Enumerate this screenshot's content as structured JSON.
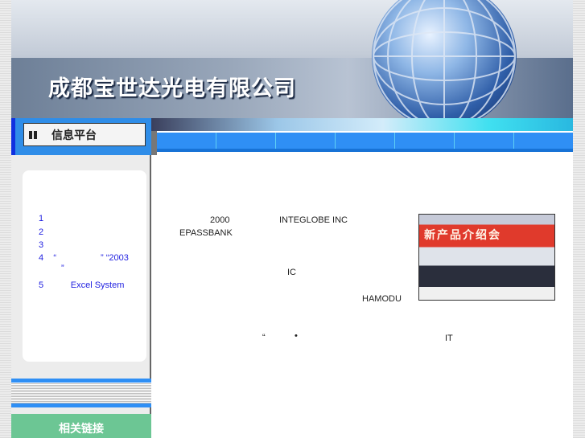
{
  "header": {
    "company_name": "成都宝世达光电有限公司"
  },
  "sidebar": {
    "info_title": "信息平台",
    "news": [
      {
        "num": "1",
        "text": ""
      },
      {
        "num": "2",
        "text": ""
      },
      {
        "num": "3",
        "text": ""
      },
      {
        "num": "4",
        "text": "“                  ” “2003"
      },
      {
        "num": "",
        "text": "”"
      },
      {
        "num": "5",
        "text": "Excel System"
      }
    ],
    "links_title": "相关链接"
  },
  "main": {
    "fragments": [
      "2000",
      "INTEGLOBE INC",
      "EPASSBANK",
      "IC",
      "HAMODU",
      "“",
      "•",
      "IT"
    ],
    "photo_banner": "新产品介绍会"
  }
}
